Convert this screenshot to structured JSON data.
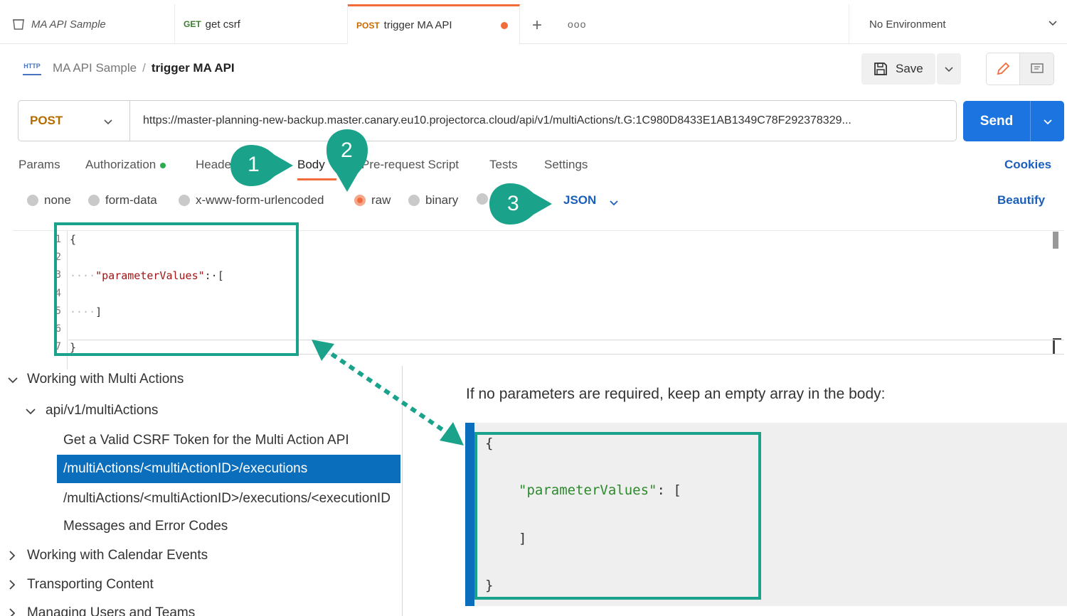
{
  "tabs": [
    {
      "label": "MA API Sample",
      "method": ""
    },
    {
      "label": "get csrf",
      "method": "GET"
    },
    {
      "label": "trigger MA API",
      "method": "POST"
    }
  ],
  "environment": "No Environment",
  "breadcrumb": {
    "collection": "MA API Sample",
    "separator": "/",
    "request": "trigger MA API",
    "icon_text": "HTTP"
  },
  "toolbar": {
    "save_label": "Save"
  },
  "request": {
    "method": "POST",
    "url": "https://master-planning-new-backup.master.canary.eu10.projectorca.cloud/api/v1/multiActions/t.G:1C980D8433E1AB1349C78F292378329...",
    "send_label": "Send"
  },
  "request_tabs": [
    "Params",
    "Authorization",
    "Heade",
    "Body",
    "Pre-request Script",
    "Tests",
    "Settings"
  ],
  "cookies_label": "Cookies",
  "body_types": [
    "none",
    "form-data",
    "x-www-form-urlencoded",
    "raw",
    "binary"
  ],
  "body_format": "JSON",
  "beautify_label": "Beautify",
  "editor": {
    "line_numbers": [
      "1",
      "2",
      "3",
      "4",
      "5",
      "6",
      "7"
    ],
    "line1": "{",
    "line3_ws": "····",
    "line3_key": "\"parameterValues\"",
    "line3_rest": ":·[",
    "line5_ws": "····",
    "line5_rest": "]",
    "line7": "}"
  },
  "annotations": [
    "1",
    "2",
    "3"
  ],
  "doc_nav": {
    "section1": "Working with Multi Actions",
    "sub1": "api/v1/multiActions",
    "item1": "Get a Valid CSRF Token for the Multi Action API",
    "item2": "/multiActions/<multiActionID>/executions",
    "item3": "/multiActions/<multiActionID>/executions/<executionID",
    "item4": "Messages and Error Codes",
    "section2": "Working with Calendar Events",
    "section3": "Transporting Content",
    "section4": "Managing Users and Teams"
  },
  "doc": {
    "heading": "If no parameters are required, keep an empty array in the body:",
    "code_open": "{",
    "code_key": "\"parameterValues\"",
    "code_rest": ": [",
    "code_close_bracket": "]",
    "code_close": "}"
  },
  "colors": {
    "accent": "#f26b3a",
    "send": "#1b74e0",
    "annotation": "#1aa38a",
    "doc_accent": "#0a6ebd"
  }
}
